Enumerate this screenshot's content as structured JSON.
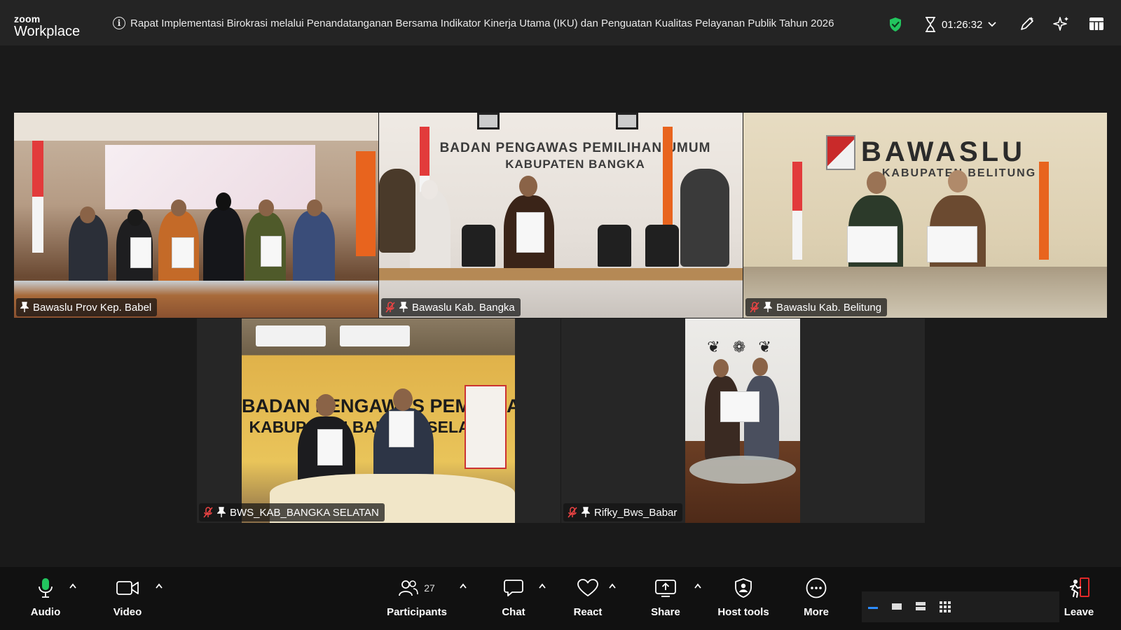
{
  "app": {
    "brand_top": "zoom",
    "brand_bottom": "Workplace"
  },
  "meeting": {
    "title": "Rapat Implementasi Birokrasi melalui Penandatanganan Bersama Indikator Kinerja Utama (IKU) dan Penguatan Kualitas Pelayanan Publik Tahun 2026",
    "elapsed": "01:26:32"
  },
  "colors": {
    "active_speaker": "#23d959",
    "encryption": "#22c55e",
    "leave": "#e02828"
  },
  "participants": [
    {
      "name": "Bawaslu Prov Kep. Babel",
      "muted": false,
      "active": true
    },
    {
      "name": "Bawaslu Kab. Bangka",
      "muted": true,
      "active": false
    },
    {
      "name": "Bawaslu Kab. Belitung",
      "muted": true,
      "active": false
    },
    {
      "name": "BWS_KAB_BANGKA SELATAN",
      "muted": true,
      "active": false
    },
    {
      "name": "Rifky_Bws_Babar",
      "muted": true,
      "active": false
    }
  ],
  "scenes": {
    "bangka_wall_1": "BADAN PENGAWAS PEMILIHAN UMUM",
    "bangka_wall_2": "KABUPATEN BANGKA",
    "belitung_logo": "BAWASLU",
    "belitung_sub": "KABUPATEN BELITUNG",
    "bangka_selatan_1": "BADAN PENGAWAS PEMILIHAN UMUM",
    "bangka_selatan_2": "KABUPATEN BANGKA SELATAN"
  },
  "toolbar": {
    "audio": "Audio",
    "video": "Video",
    "participants": "Participants",
    "participants_count": "27",
    "chat": "Chat",
    "react": "React",
    "share": "Share",
    "host_tools": "Host tools",
    "more": "More",
    "leave": "Leave"
  },
  "icons": [
    "info-icon",
    "shield-check-icon",
    "hourglass-icon",
    "chevron-down-icon",
    "pen-icon",
    "sparkle-icon",
    "grid-view-icon",
    "microphone-icon",
    "camera-icon",
    "people-icon",
    "chat-bubble-icon",
    "heart-icon",
    "share-screen-icon",
    "shield-icon",
    "ellipsis-icon",
    "leave-icon",
    "mic-off-icon",
    "pin-icon"
  ]
}
